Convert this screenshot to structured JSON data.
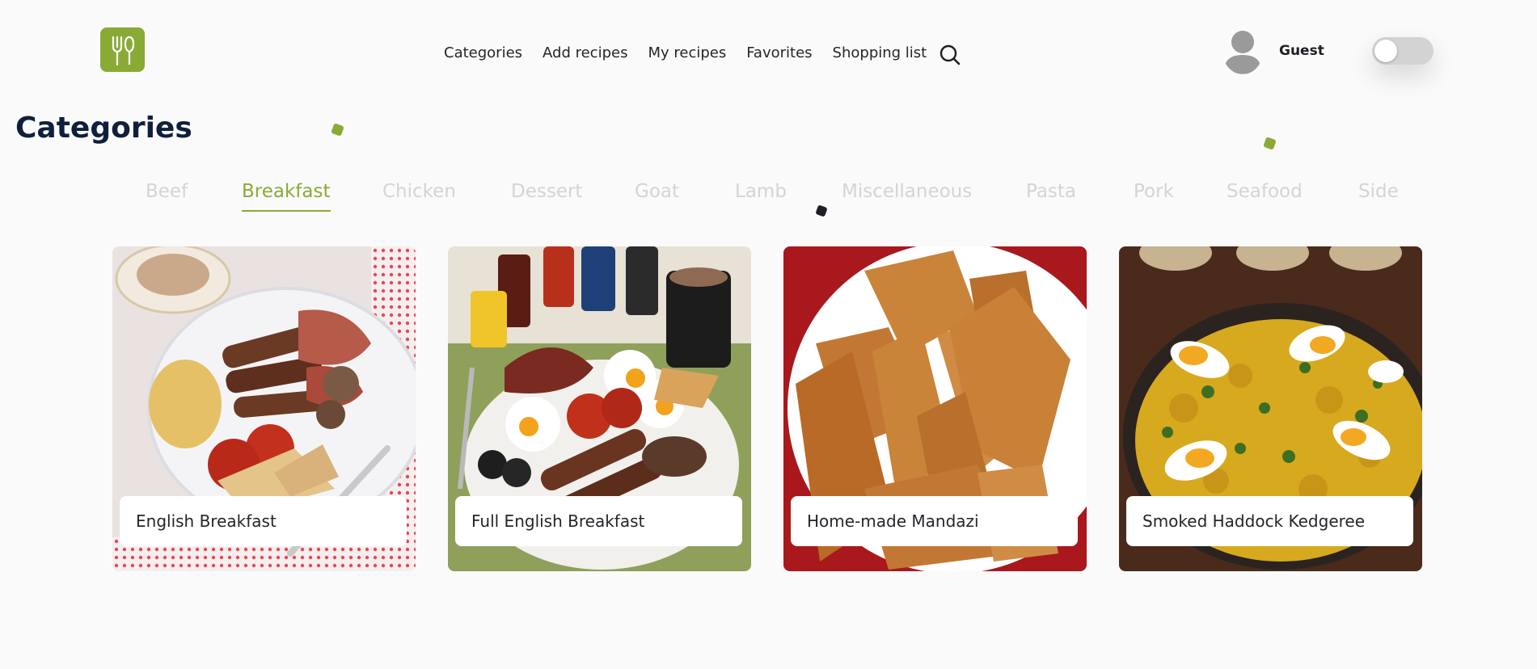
{
  "header": {
    "nav": [
      {
        "label": "Categories"
      },
      {
        "label": "Add recipes"
      },
      {
        "label": "My recipes"
      },
      {
        "label": "Favorites"
      },
      {
        "label": "Shopping list"
      }
    ],
    "user_name": "Guest",
    "icons": {
      "logo": "fork-spoon-icon",
      "search": "search-icon",
      "avatar": "user-avatar-icon"
    }
  },
  "page": {
    "title": "Categories"
  },
  "categories": {
    "tabs": [
      "Beef",
      "Breakfast",
      "Chicken",
      "Dessert",
      "Goat",
      "Lamb",
      "Miscellaneous",
      "Pasta",
      "Pork",
      "Seafood",
      "Side"
    ],
    "active": "Breakfast"
  },
  "recipes": [
    {
      "title": "English Breakfast"
    },
    {
      "title": "Full English Breakfast"
    },
    {
      "title": "Home-made Mandazi"
    },
    {
      "title": "Smoked Haddock Kedgeree"
    }
  ],
  "colors": {
    "accent": "#8aaa36",
    "title": "#0f1f3d",
    "tab_inactive": "#d4d4d4"
  }
}
